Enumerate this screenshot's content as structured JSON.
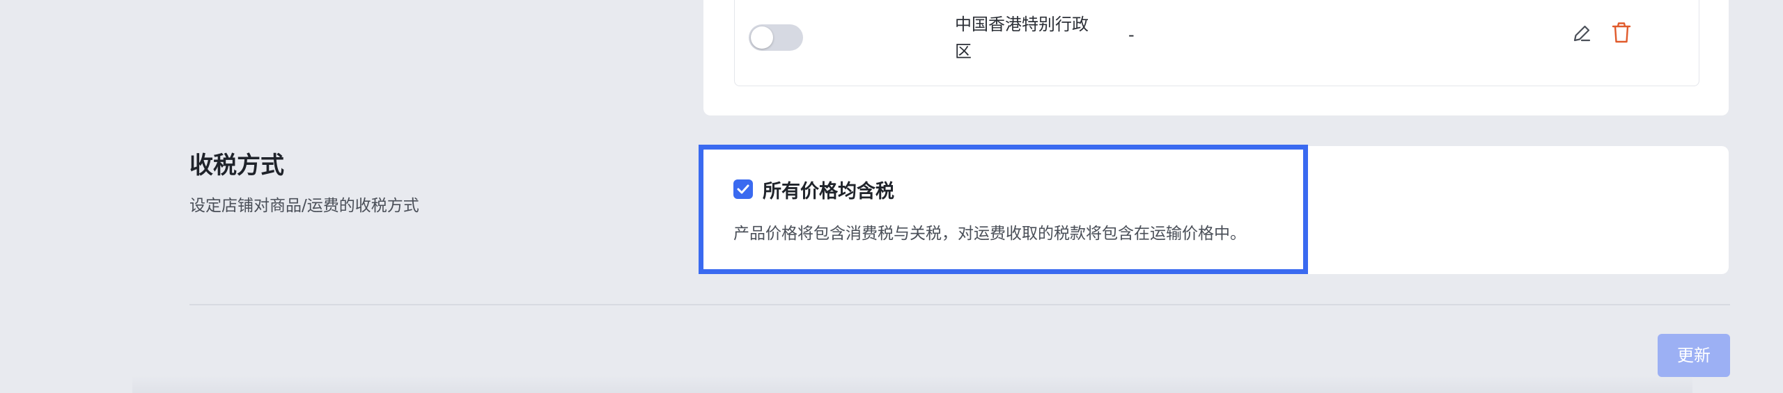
{
  "region_row": {
    "toggle_state": "off",
    "region_name": "中国香港特别行政区",
    "value": "-",
    "edit_icon": "pencil-icon",
    "delete_icon": "trash-icon"
  },
  "tax_section": {
    "title": "收税方式",
    "description": "设定店铺对商品/运费的收税方式",
    "option_checked": true,
    "option_label": "所有价格均含税",
    "option_help": "产品价格将包含消费税与关税，对运费收取的税款将包含在运输价格中。"
  },
  "footer": {
    "update_label": "更新"
  },
  "colors": {
    "accent": "#3a6af0",
    "button_disabled": "#9cb0f4",
    "delete_red": "#e05a2b",
    "background": "#e8eaef"
  }
}
